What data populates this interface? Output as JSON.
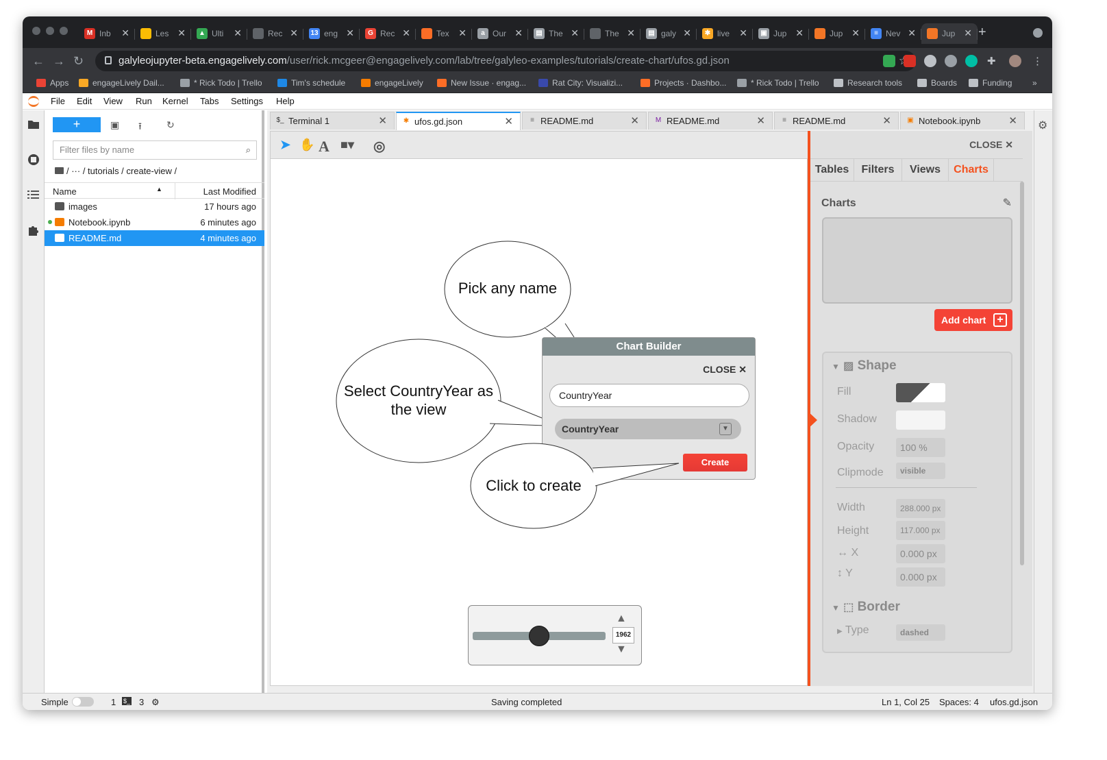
{
  "browser": {
    "tabs": [
      {
        "label": "Inb",
        "color": "#d93025",
        "glyph": "M",
        "active": false
      },
      {
        "label": "Les",
        "color": "#fbbc04",
        "glyph": "",
        "active": false
      },
      {
        "label": "Ulti",
        "color": "#34a853",
        "glyph": "▲",
        "active": false
      },
      {
        "label": "Rec",
        "color": "#5f6368",
        "glyph": "",
        "active": false
      },
      {
        "label": "eng",
        "color": "#4285f4",
        "glyph": "13",
        "active": false
      },
      {
        "label": "Rec",
        "color": "#ea4335",
        "glyph": "G",
        "active": false
      },
      {
        "label": "Tex",
        "color": "#fc6d26",
        "glyph": "",
        "active": false
      },
      {
        "label": "Our",
        "color": "#9aa0a6",
        "glyph": "a",
        "active": false
      },
      {
        "label": "The",
        "color": "#9aa0a6",
        "glyph": "▤",
        "active": false
      },
      {
        "label": "The",
        "color": "#5f6368",
        "glyph": "",
        "active": false
      },
      {
        "label": "galy",
        "color": "#9aa0a6",
        "glyph": "▤",
        "active": false
      },
      {
        "label": "live",
        "color": "#f9a825",
        "glyph": "✱",
        "active": false
      },
      {
        "label": "Jup",
        "color": "#9aa0a6",
        "glyph": "▣",
        "active": false
      },
      {
        "label": "Jup",
        "color": "#f37626",
        "glyph": "",
        "active": false
      },
      {
        "label": "Nev",
        "color": "#4285f4",
        "glyph": "≡",
        "active": false
      },
      {
        "label": "Jup",
        "color": "#f37626",
        "glyph": "",
        "active": true
      }
    ],
    "url_host": "galyleojupyter-beta.engagelively.com",
    "url_path": "/user/rick.mcgeer@engagelively.com/lab/tree/galyleo-examples/tutorials/create-chart/ufos.gd.json",
    "bookmarks": [
      {
        "label": "Apps",
        "color": "#ea4335"
      },
      {
        "label": "engageLively Dail...",
        "color": "#f9a825"
      },
      {
        "label": "* Rick Todo | Trello",
        "color": "#9aa0a6"
      },
      {
        "label": "Tim's schedule",
        "color": "#1e88e5"
      },
      {
        "label": "engageLively",
        "color": "#f57c00"
      },
      {
        "label": "New Issue · engag...",
        "color": "#fc6d26"
      },
      {
        "label": "Rat City: Visualizi...",
        "color": "#3949ab"
      },
      {
        "label": "Projects · Dashbo...",
        "color": "#fc6d26"
      },
      {
        "label": "* Rick Todo | Trello",
        "color": "#9aa0a6"
      },
      {
        "label": "Research tools",
        "color": "#bdc1c6"
      },
      {
        "label": "Boards",
        "color": "#bdc1c6"
      },
      {
        "label": "Funding",
        "color": "#bdc1c6"
      }
    ],
    "bookmarks_more": "»"
  },
  "menu": [
    "File",
    "Edit",
    "View",
    "Run",
    "Kernel",
    "Tabs",
    "Settings",
    "Help"
  ],
  "filebrowser": {
    "new_label": "+",
    "filter_placeholder": "Filter files by name",
    "breadcrumb": "/   ···   / tutorials / create-view /",
    "col_name": "Name",
    "col_modified": "Last Modified",
    "files": [
      {
        "name": "images",
        "modified": "17 hours ago",
        "type": "folder"
      },
      {
        "name": "Notebook.ipynb",
        "modified": "6 minutes ago",
        "type": "notebook"
      },
      {
        "name": "README.md",
        "modified": "4 minutes ago",
        "type": "markdown"
      }
    ]
  },
  "doc_tabs": [
    {
      "label": "Terminal 1",
      "icon": "$_",
      "color": "#333"
    },
    {
      "label": "ufos.gd.json",
      "icon": "✱",
      "color": "#f57c00"
    },
    {
      "label": "README.md",
      "icon": "≡",
      "color": "#666"
    },
    {
      "label": "README.md",
      "icon": "M",
      "color": "#7b1fa2"
    },
    {
      "label": "README.md",
      "icon": "≡",
      "color": "#666"
    },
    {
      "label": "Notebook.ipynb",
      "icon": "▣",
      "color": "#f57c00"
    }
  ],
  "callouts": {
    "pick_name": "Pick any name",
    "select_line1": "Select CountryYear as",
    "select_line2": "the view",
    "click_create": "Click to create"
  },
  "builder": {
    "title": "Chart Builder",
    "close": "CLOSE ✕",
    "name_value": "CountryYear",
    "view_value": "CountryYear",
    "create": "Create"
  },
  "slider": {
    "value": "1962",
    "position_pct": 50
  },
  "panel": {
    "close": "CLOSE ✕",
    "tabs": [
      "Tables",
      "Filters",
      "Views",
      "Charts"
    ],
    "active_tab": "Charts",
    "charts_title": "Charts",
    "add_chart": "Add chart",
    "shape_title": "Shape",
    "fill_label": "Fill",
    "shadow_label": "Shadow",
    "opacity_label": "Opacity",
    "opacity_value": "100 %",
    "clipmode_label": "Clipmode",
    "clipmode_value": "visible",
    "width_label": "Width",
    "width_value": "288.000 px",
    "height_label": "Height",
    "height_value": "117.000 px",
    "x_label": "X",
    "x_value": "0.000 px",
    "y_label": "Y",
    "y_value": "0.000 px",
    "border_title": "Border",
    "type_label": "Type",
    "type_value": "dashed"
  },
  "status": {
    "mode": "Simple",
    "kernels": "1",
    "terminals": "3",
    "message": "Saving completed",
    "cursor": "Ln 1, Col 25",
    "spaces": "Spaces: 4",
    "file": "ufos.gd.json"
  },
  "colors": {
    "accent": "#2196f3",
    "panel_accent": "#f4511e",
    "create": "#f44336"
  }
}
